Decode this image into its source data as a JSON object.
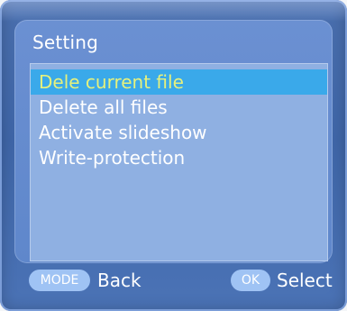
{
  "menu": {
    "title": "Setting",
    "items": [
      {
        "label": "Dele current file",
        "selected": true
      },
      {
        "label": "Delete all files",
        "selected": false
      },
      {
        "label": "Activate slideshow",
        "selected": false
      },
      {
        "label": "Write-protection",
        "selected": false
      }
    ]
  },
  "footer": {
    "mode_key": "MODE",
    "back_label": "Back",
    "ok_key": "OK",
    "select_label": "Select"
  },
  "colors": {
    "background": "#4a6fae",
    "panel": "#6b90d2",
    "list": "#8fb0e2",
    "selection": "#3aa9ea",
    "selected_text": "#e6f17c",
    "pill": "#9fc3f4"
  }
}
